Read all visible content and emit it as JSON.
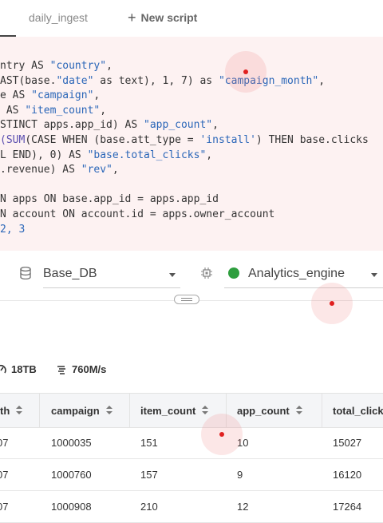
{
  "tabs": {
    "daily_ingest": "daily_ingest",
    "new_script": "New script"
  },
  "editor": {
    "lines": [
      [
        {
          "t": "ntry ",
          "c": "kw"
        },
        {
          "t": "AS ",
          "c": "kw"
        },
        {
          "t": "\"country\"",
          "c": "str"
        },
        {
          "t": ",",
          "c": "kw"
        }
      ],
      [
        {
          "t": "AST(base.",
          "c": "kw"
        },
        {
          "t": "\"date\"",
          "c": "str"
        },
        {
          "t": " as text), 1, 7) as ",
          "c": "kw"
        },
        {
          "t": "\"campaign_month\"",
          "c": "str"
        },
        {
          "t": ",",
          "c": "kw"
        }
      ],
      [
        {
          "t": "e AS ",
          "c": "kw"
        },
        {
          "t": "\"campaign\"",
          "c": "str"
        },
        {
          "t": ",",
          "c": "kw"
        }
      ],
      [
        {
          "t": " AS ",
          "c": "kw"
        },
        {
          "t": "\"item_count\"",
          "c": "str"
        },
        {
          "t": ",",
          "c": "kw"
        }
      ],
      [
        {
          "t": "STINCT apps.app_id) AS ",
          "c": "kw"
        },
        {
          "t": "\"app_count\"",
          "c": "str"
        },
        {
          "t": ",",
          "c": "kw"
        }
      ],
      [
        {
          "t": "(SUM",
          "c": "fn"
        },
        {
          "t": "(CASE WHEN (base.att_type = ",
          "c": "kw"
        },
        {
          "t": "'install'",
          "c": "str"
        },
        {
          "t": ") THEN base.clicks",
          "c": "kw"
        }
      ],
      [
        {
          "t": "L END), 0) AS ",
          "c": "kw"
        },
        {
          "t": "\"base.total_clicks\"",
          "c": "str"
        },
        {
          "t": ",",
          "c": "kw"
        }
      ],
      [
        {
          "t": ".revenue) AS ",
          "c": "kw"
        },
        {
          "t": "\"rev\"",
          "c": "str"
        },
        {
          "t": ",",
          "c": "kw"
        }
      ],
      [
        {
          "t": "",
          "c": "kw"
        }
      ],
      [
        {
          "t": "N apps ON base.app_id = apps.app_id",
          "c": "kw"
        }
      ],
      [
        {
          "t": "N account ON account.id = apps.owner_account",
          "c": "kw"
        }
      ],
      [
        {
          "t": "2, 3",
          "c": "num"
        }
      ]
    ]
  },
  "selectors": {
    "database_value": "Base_DB",
    "engine_value": "Analytics_engine",
    "engine_status_color": "#2e9e3e"
  },
  "stats": {
    "size": "18TB",
    "speed": "760M/s"
  },
  "table": {
    "columns": [
      "th",
      "campaign",
      "item_count",
      "app_count",
      "total_click"
    ],
    "rows": [
      [
        "07",
        "1000035",
        "151",
        "10",
        "15027"
      ],
      [
        "07",
        "1000760",
        "157",
        "9",
        "16120"
      ],
      [
        "07",
        "1000908",
        "210",
        "12",
        "17264"
      ]
    ]
  }
}
